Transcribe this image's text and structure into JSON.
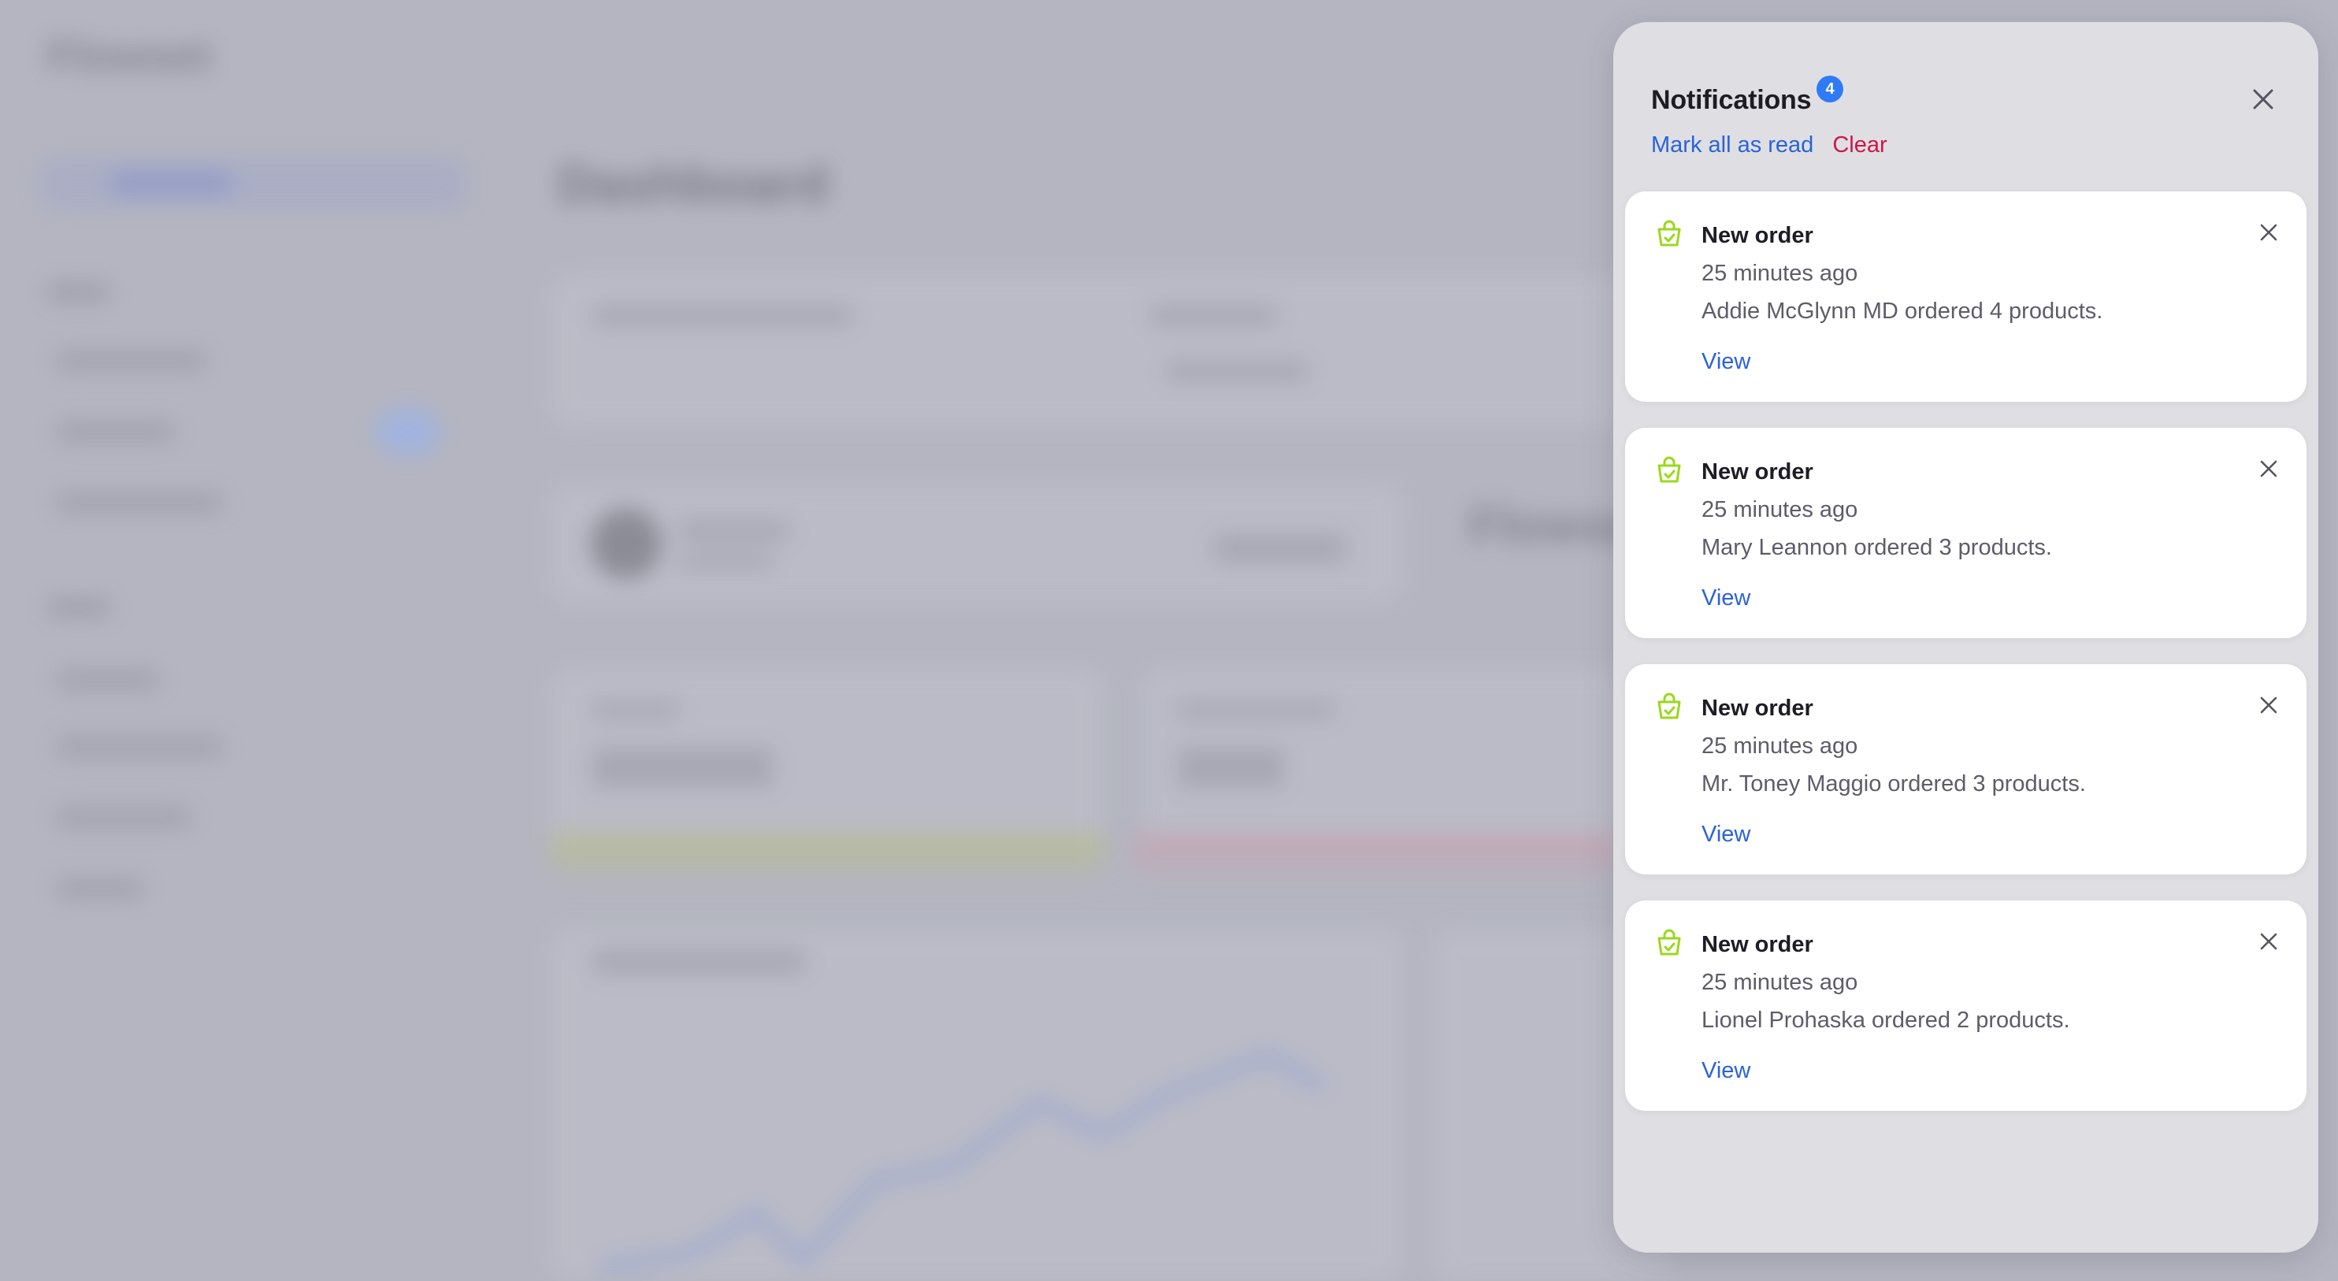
{
  "background": {
    "logo": "Flowset",
    "page_title": "Dashboard"
  },
  "drawer": {
    "title": "Notifications",
    "unread_count": "4",
    "mark_all_label": "Mark all as read",
    "clear_label": "Clear",
    "close_icon": "close-icon",
    "colors": {
      "badge": "#2f7bf6",
      "link": "#2b62d9",
      "clear": "#d01548",
      "order_icon": "#9bd81c"
    }
  },
  "notifications": [
    {
      "icon": "shopping-bag-icon",
      "title": "New order",
      "time": "25 minutes ago",
      "body": "Addie McGlynn MD ordered 4 products.",
      "action": "View"
    },
    {
      "icon": "shopping-bag-icon",
      "title": "New order",
      "time": "25 minutes ago",
      "body": "Mary Leannon ordered 3 products.",
      "action": "View"
    },
    {
      "icon": "shopping-bag-icon",
      "title": "New order",
      "time": "25 minutes ago",
      "body": "Mr. Toney Maggio ordered 3 products.",
      "action": "View"
    },
    {
      "icon": "shopping-bag-icon",
      "title": "New order",
      "time": "25 minutes ago",
      "body": "Lionel Prohaska ordered 2 products.",
      "action": "View"
    }
  ]
}
